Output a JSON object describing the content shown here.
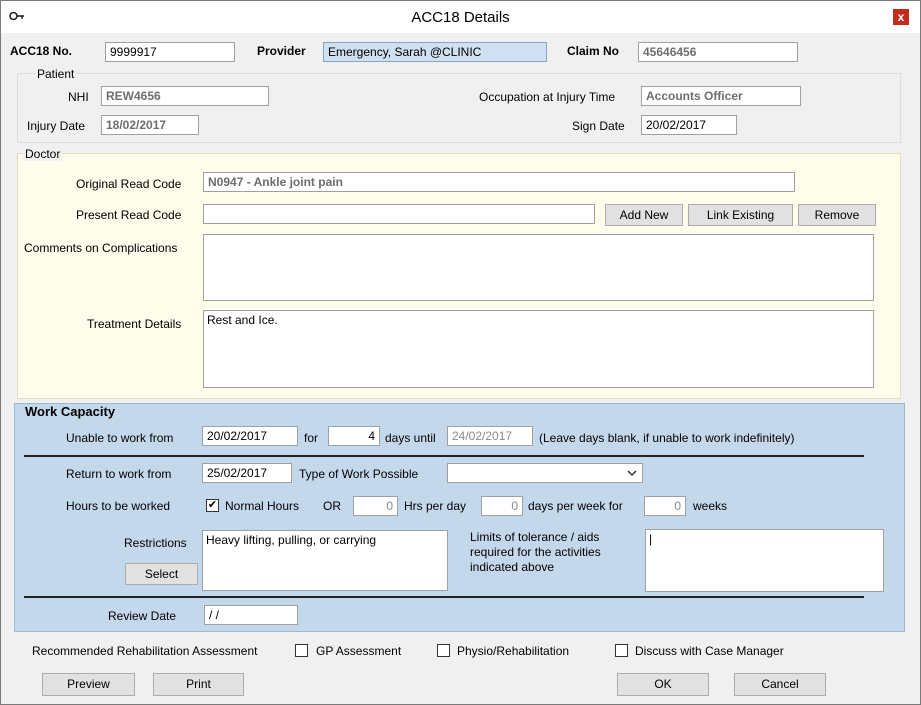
{
  "window": {
    "title": "ACC18  Details",
    "close": "x"
  },
  "header": {
    "acc18_label": "ACC18 No.",
    "acc18_value": "9999917",
    "provider_label": "Provider",
    "provider_value": "Emergency, Sarah @CLINIC",
    "claim_label": "Claim No",
    "claim_value": "45646456"
  },
  "patient": {
    "group_label": "Patient",
    "nhi_label": "NHI",
    "nhi_value": "REW4656",
    "occupation_label": "Occupation at Injury Time",
    "occupation_value": "Accounts Officer",
    "injury_date_label": "Injury Date",
    "injury_date_value": "18/02/2017",
    "sign_date_label": "Sign Date",
    "sign_date_value": "20/02/2017"
  },
  "doctor": {
    "group_label": "Doctor",
    "original_read_label": "Original Read Code",
    "original_read_value": "N0947 - Ankle joint pain",
    "present_read_label": "Present Read Code",
    "present_read_value": "",
    "add_new": "Add New",
    "link_existing": "Link Existing",
    "remove": "Remove",
    "comments_label": "Comments on Complications",
    "comments_value": "",
    "treatment_label": "Treatment Details",
    "treatment_value": "Rest and Ice."
  },
  "work": {
    "heading": "Work Capacity",
    "unable_label": "Unable to work  from",
    "unable_from": "20/02/2017",
    "for_label": "for",
    "days_value": "4",
    "days_until_label": "days  until",
    "until_value": "24/02/2017",
    "unable_note": "(Leave days blank, if unable to work indefinitely)",
    "return_label": "Return to work  from",
    "return_from": "25/02/2017",
    "type_label": "Type of Work Possible",
    "type_value": "",
    "hours_label": "Hours to be worked",
    "normal_hours_label": "Normal Hours",
    "normal_hours_checked": "✔",
    "or_label": "OR",
    "hrs_value": "0",
    "hrs_per_day_label": "Hrs per day",
    "dpw_value": "0",
    "dpw_label": "days per week for",
    "weeks_value": "0",
    "weeks_label": "weeks",
    "restrictions_label": "Restrictions",
    "restrictions_value": "Heavy lifting, pulling, or carrying",
    "select_button": "Select",
    "limits_label": "Limits of tolerance / aids required for the activities indicated above",
    "limits_value": "|",
    "review_label": "Review Date",
    "review_value": " /  /"
  },
  "rehab": {
    "label": "Recommended Rehabilitation Assessment",
    "gp": "GP Assessment",
    "physio": "Physio/Rehabilitation",
    "discuss": "Discuss with Case Manager"
  },
  "footer": {
    "preview": "Preview",
    "print": "Print",
    "ok": "OK",
    "cancel": "Cancel"
  }
}
